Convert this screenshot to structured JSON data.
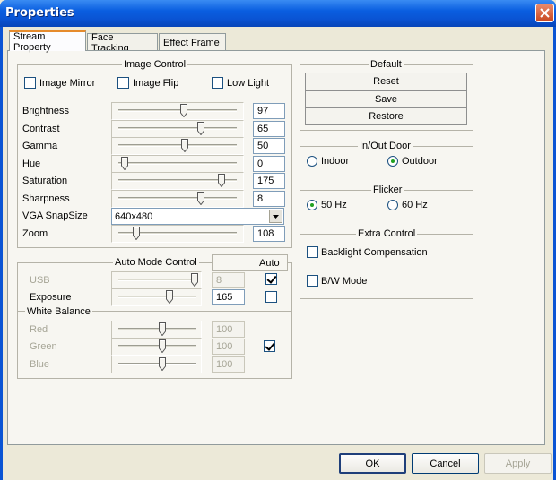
{
  "window": {
    "title": "Properties"
  },
  "tabs": [
    "Stream Property",
    "Face Tracking",
    "Effect  Frame"
  ],
  "image_control": {
    "title": "Image Control",
    "checkboxes": [
      {
        "label": "Image Mirror",
        "checked": false
      },
      {
        "label": "Image Flip",
        "checked": false
      },
      {
        "label": "Low Light",
        "checked": false
      }
    ],
    "sliders": [
      {
        "label": "Brightness",
        "value": "97",
        "pos": 0.55
      },
      {
        "label": "Contrast",
        "value": "65",
        "pos": 0.7
      },
      {
        "label": "Gamma",
        "value": "50",
        "pos": 0.56
      },
      {
        "label": "Hue",
        "value": "0",
        "pos": 0.05
      },
      {
        "label": "Saturation",
        "value": "175",
        "pos": 0.87
      },
      {
        "label": "Sharpness",
        "value": "8",
        "pos": 0.7
      }
    ],
    "vga_label": "VGA SnapSize",
    "vga_value": "640x480",
    "zoom": {
      "label": "Zoom",
      "value": "108",
      "pos": 0.15
    }
  },
  "auto_mode": {
    "title": "Auto Mode Control",
    "auto_header": "Auto",
    "usb": {
      "label": "USB",
      "value": "8",
      "pos": 0.98,
      "auto": true
    },
    "exposure": {
      "label": "Exposure",
      "value": "165",
      "pos": 0.66,
      "auto": false
    },
    "white_balance": {
      "title": "White Balance",
      "auto": true,
      "channels": [
        {
          "label": "Red",
          "value": "100",
          "pos": 0.56
        },
        {
          "label": "Green",
          "value": "100",
          "pos": 0.56
        },
        {
          "label": "Blue",
          "value": "100",
          "pos": 0.56
        }
      ]
    }
  },
  "default_group": {
    "title": "Default",
    "buttons": [
      "Reset",
      "Save",
      "Restore"
    ]
  },
  "inout_door": {
    "title": "In/Out Door",
    "options": [
      "Indoor",
      "Outdoor"
    ],
    "selected": "Outdoor"
  },
  "flicker": {
    "title": "Flicker",
    "options": [
      "50 Hz",
      "60 Hz"
    ],
    "selected": "50 Hz"
  },
  "extra_control": {
    "title": "Extra Control",
    "checkboxes": [
      {
        "label": "Backlight Compensation",
        "checked": false
      },
      {
        "label": "B/W Mode",
        "checked": false
      }
    ]
  },
  "footer": {
    "ok": "OK",
    "cancel": "Cancel",
    "apply": "Apply"
  }
}
